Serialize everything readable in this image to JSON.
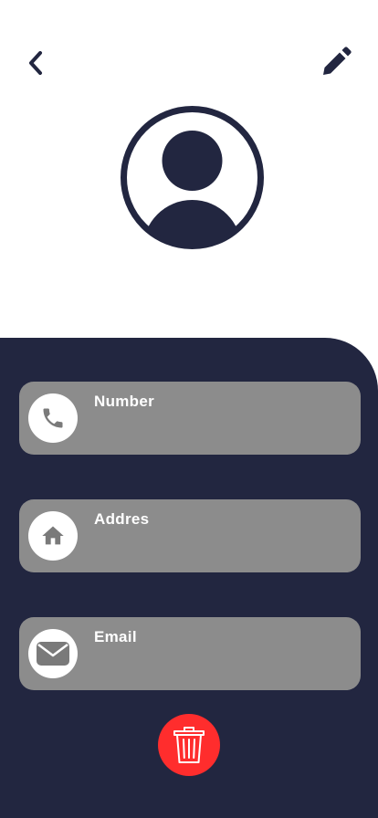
{
  "header": {
    "back_icon": "chevron-left-icon",
    "edit_icon": "pencil-icon"
  },
  "profile": {
    "avatar_icon": "user-avatar-icon"
  },
  "fields": [
    {
      "label": "Number",
      "icon": "phone-icon"
    },
    {
      "label": "Addres",
      "icon": "home-icon"
    },
    {
      "label": "Email",
      "icon": "mail-icon"
    }
  ],
  "actions": {
    "delete_icon": "trash-icon"
  },
  "colors": {
    "primary_dark": "#222640",
    "card_gray": "#8c8c8c",
    "delete_red": "#ff2d2d",
    "white": "#ffffff"
  }
}
